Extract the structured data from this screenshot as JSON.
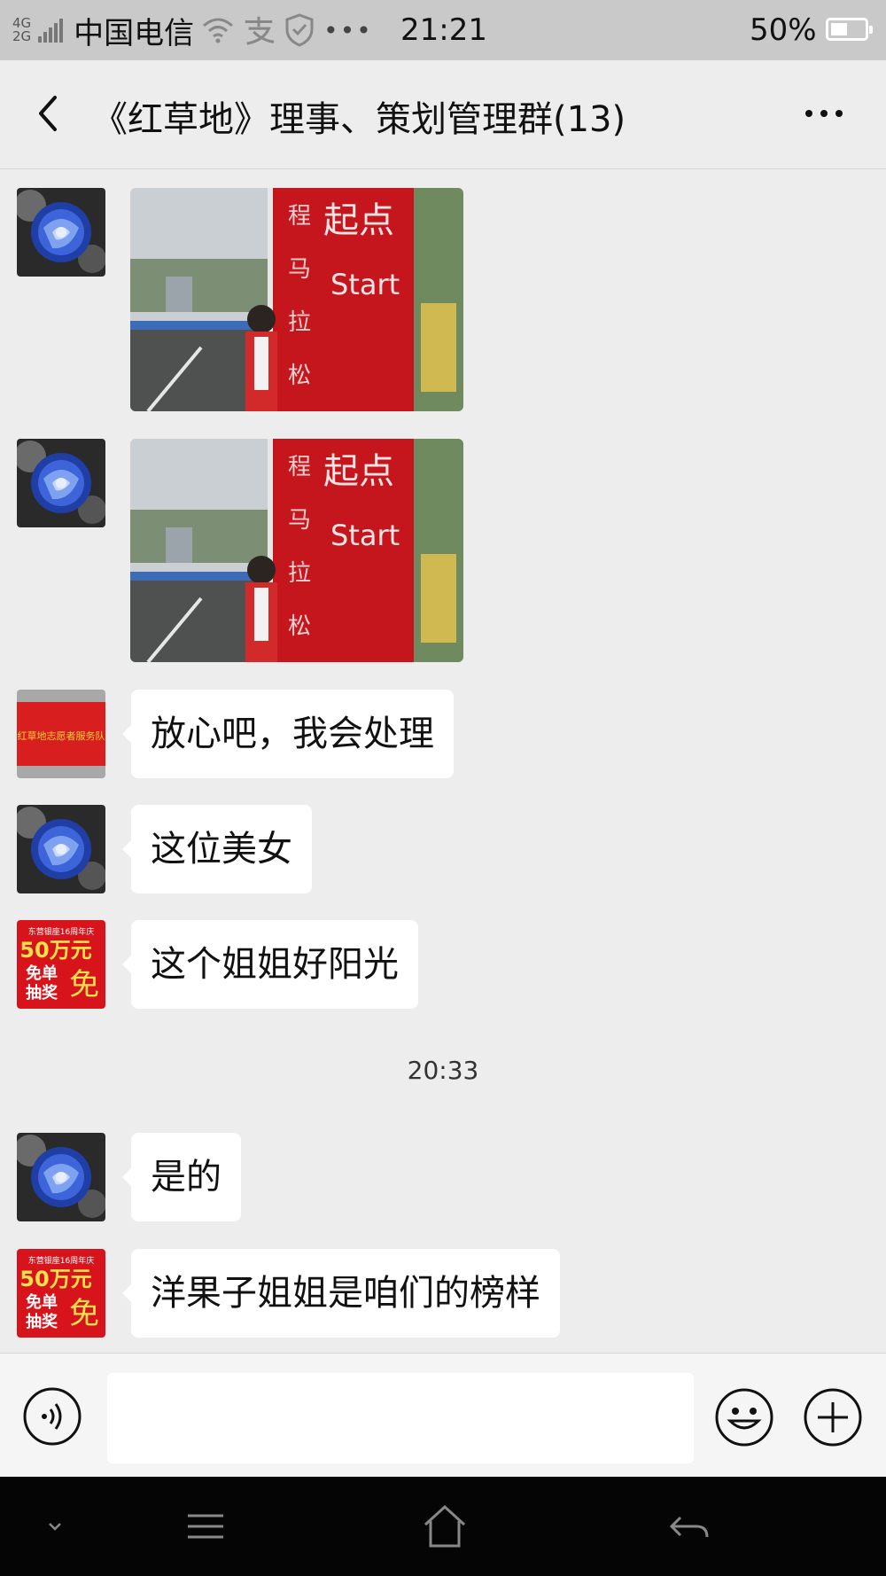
{
  "status_bar": {
    "network_top": "4G",
    "network_bottom": "2G",
    "carrier": "中国电信",
    "time": "21:21",
    "battery": "50%",
    "battery_level": 0.5,
    "icons": [
      "signal-icon",
      "wifi-icon",
      "alipay-icon",
      "shield-icon",
      "more-dots-icon"
    ]
  },
  "header": {
    "title": "《红草地》理事、策划管理群(13)",
    "back_icon": "chevron-left-icon",
    "more_icon": "more-horizontal-icon"
  },
  "messages": [
    {
      "type": "image",
      "avatar": "blue-rose-avatar",
      "image": "marathon-start-photo",
      "photo_text": [
        "程",
        "马",
        "拉",
        "松",
        "起点",
        "Start"
      ]
    },
    {
      "type": "image",
      "avatar": "blue-rose-avatar",
      "image": "marathon-start-photo",
      "photo_text": [
        "程",
        "马",
        "拉",
        "松",
        "起点",
        "Start"
      ]
    },
    {
      "type": "text",
      "avatar": "red-banner-avatar",
      "text": "放心吧，我会处理"
    },
    {
      "type": "text",
      "avatar": "blue-rose-avatar",
      "text": "这位美女"
    },
    {
      "type": "text",
      "avatar": "lottery-poster-avatar",
      "text": "这个姐姐好阳光"
    },
    {
      "type": "timestamp",
      "text": "20:33"
    },
    {
      "type": "text",
      "avatar": "blue-rose-avatar",
      "text": "是的"
    },
    {
      "type": "text",
      "avatar": "lottery-poster-avatar",
      "text": "洋果子姐姐是咱们的榜样"
    }
  ],
  "avatar_text": {
    "red_banner": "红草地志愿者服务队",
    "lottery": [
      "东营银座16周年庆",
      "50万元",
      "免单",
      "抽奖",
      "免"
    ]
  },
  "input_bar": {
    "voice_icon": "voice-icon",
    "text_value": "",
    "emoji_icon": "emoji-icon",
    "plus_icon": "plus-circle-icon"
  },
  "nav_bar": {
    "icons": [
      "chevron-down-icon",
      "menu-icon",
      "home-icon",
      "back-arrow-icon"
    ]
  },
  "colors": {
    "background": "#ededed",
    "status_bar": "#c9c9c9",
    "bubble": "#ffffff",
    "nav_bar": "#050505",
    "sign_red": "#c4161c"
  }
}
